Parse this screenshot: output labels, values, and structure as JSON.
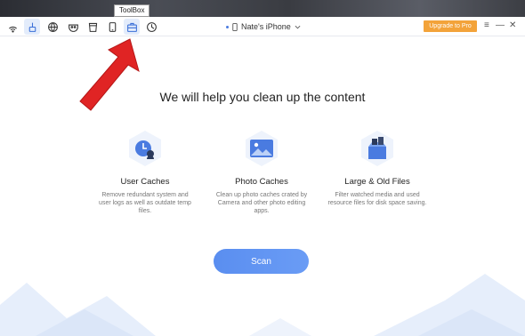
{
  "toolbar": {
    "icons": [
      "wifi-icon",
      "broom-icon",
      "globe-icon",
      "mask-icon",
      "cup-icon",
      "phone-icon",
      "toolbox-icon",
      "history-icon"
    ],
    "tooltip": "ToolBox"
  },
  "device": {
    "name": "Nate's iPhone"
  },
  "upgrade_label": "Upgrade to Pro",
  "window_controls": {
    "menu": "≡",
    "minimize": "—",
    "close": "✕"
  },
  "main": {
    "headline": "We will help you clean up the content",
    "features": [
      {
        "title": "User Caches",
        "description": "Remove redundant system and user logs as well as outdate temp files."
      },
      {
        "title": "Photo Caches",
        "description": "Clean up photo caches crated by Camera and other photo editing apps."
      },
      {
        "title": "Large & Old Files",
        "description": "Filter watched media and used resource files for disk space saving."
      }
    ],
    "scan_label": "Scan"
  },
  "colors": {
    "accent": "#5a8ef0",
    "upgrade": "#f3a33a",
    "arrow": "#e02424"
  }
}
